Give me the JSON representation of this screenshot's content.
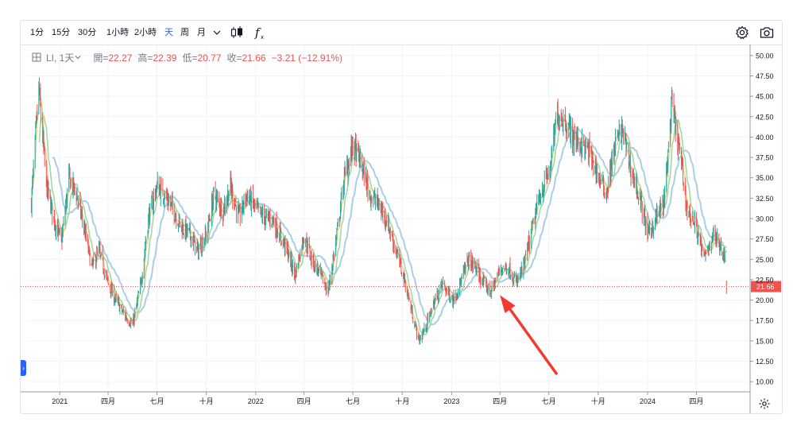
{
  "toolbar": {
    "intervals": [
      {
        "label": "1分",
        "active": false
      },
      {
        "label": "15分",
        "active": false
      },
      {
        "label": "30分",
        "active": false
      },
      {
        "label": "1小時",
        "active": false
      },
      {
        "label": "2小時",
        "active": false
      },
      {
        "label": "天",
        "active": true
      },
      {
        "label": "周",
        "active": false
      },
      {
        "label": "月",
        "active": false
      }
    ],
    "more_icon": "chevron-down-icon",
    "chart_type_icon": "candles-icon",
    "indicators_icon": "fx-icon",
    "settings_icon": "gear-icon",
    "snapshot_icon": "camera-icon"
  },
  "legend": {
    "symbol": "LI, 1天",
    "open_label": "開=",
    "open": "22.27",
    "high_label": "高=",
    "high": "22.39",
    "low_label": "低=",
    "low": "20.77",
    "close_label": "收=",
    "close": "21.66",
    "change": "−3.21 (−12.91%)"
  },
  "colors": {
    "up": "#26a69a",
    "down": "#ef5350",
    "ma_short": "#f0d68a",
    "ma_mid": "#a5d6a7",
    "ma_long": "#a9cfe0",
    "price_line": "#ef5350",
    "arrow": "#f23b2e",
    "accent": "#2962ff"
  },
  "chart_data": {
    "type": "candlestick",
    "symbol": "LI",
    "interval": "1天",
    "y_axis": {
      "min": 8.75,
      "max": 51.25,
      "ticks": [
        "10.00",
        "12.50",
        "15.00",
        "17.50",
        "20.00",
        "22.50",
        "25.00",
        "27.50",
        "30.00",
        "32.50",
        "35.00",
        "37.50",
        "40.00",
        "42.50",
        "45.00",
        "47.50",
        "50.00"
      ]
    },
    "x_axis": {
      "start": "2020-11-01",
      "end": "2024-07-10",
      "ticks": [
        {
          "label": "2021",
          "date": "2021-01-01"
        },
        {
          "label": "四月",
          "date": "2021-04-01"
        },
        {
          "label": "七月",
          "date": "2021-07-01"
        },
        {
          "label": "十月",
          "date": "2021-10-01"
        },
        {
          "label": "2022",
          "date": "2022-01-01"
        },
        {
          "label": "四月",
          "date": "2022-04-01"
        },
        {
          "label": "七月",
          "date": "2022-07-01"
        },
        {
          "label": "十月",
          "date": "2022-10-01"
        },
        {
          "label": "2023",
          "date": "2023-01-01"
        },
        {
          "label": "四月",
          "date": "2023-04-01"
        },
        {
          "label": "七月",
          "date": "2023-07-01"
        },
        {
          "label": "十月",
          "date": "2023-10-01"
        },
        {
          "label": "2024",
          "date": "2024-01-01"
        },
        {
          "label": "四月",
          "date": "2024-04-01"
        }
      ]
    },
    "last_price": 21.66,
    "last_price_label": "21.66",
    "price_path": [
      [
        "2020-11-09",
        32
      ],
      [
        "2020-11-23",
        46
      ],
      [
        "2020-12-07",
        34
      ],
      [
        "2020-12-21",
        30
      ],
      [
        "2021-01-04",
        27
      ],
      [
        "2021-01-18",
        35
      ],
      [
        "2021-02-01",
        33
      ],
      [
        "2021-02-15",
        29
      ],
      [
        "2021-03-01",
        24
      ],
      [
        "2021-03-15",
        26
      ],
      [
        "2021-04-01",
        22
      ],
      [
        "2021-04-15",
        20
      ],
      [
        "2021-05-03",
        18
      ],
      [
        "2021-05-17",
        17
      ],
      [
        "2021-06-01",
        22
      ],
      [
        "2021-06-15",
        30
      ],
      [
        "2021-07-01",
        34
      ],
      [
        "2021-07-15",
        33
      ],
      [
        "2021-08-01",
        31
      ],
      [
        "2021-08-15",
        29
      ],
      [
        "2021-09-01",
        28
      ],
      [
        "2021-09-15",
        26
      ],
      [
        "2021-10-01",
        28
      ],
      [
        "2021-10-15",
        33
      ],
      [
        "2021-11-01",
        31
      ],
      [
        "2021-11-15",
        34
      ],
      [
        "2021-12-01",
        30
      ],
      [
        "2021-12-15",
        33
      ],
      [
        "2022-01-03",
        31
      ],
      [
        "2022-01-17",
        30
      ],
      [
        "2022-02-01",
        30
      ],
      [
        "2022-02-15",
        28
      ],
      [
        "2022-03-01",
        26
      ],
      [
        "2022-03-15",
        23
      ],
      [
        "2022-04-01",
        28
      ],
      [
        "2022-04-15",
        25
      ],
      [
        "2022-05-02",
        23
      ],
      [
        "2022-05-16",
        21
      ],
      [
        "2022-06-01",
        28
      ],
      [
        "2022-06-15",
        35
      ],
      [
        "2022-07-01",
        39
      ],
      [
        "2022-07-15",
        37
      ],
      [
        "2022-08-01",
        33
      ],
      [
        "2022-08-15",
        32
      ],
      [
        "2022-09-01",
        30
      ],
      [
        "2022-09-15",
        27
      ],
      [
        "2022-10-03",
        23
      ],
      [
        "2022-10-17",
        19
      ],
      [
        "2022-11-01",
        15
      ],
      [
        "2022-11-15",
        17
      ],
      [
        "2022-12-01",
        20
      ],
      [
        "2022-12-15",
        22
      ],
      [
        "2023-01-03",
        20
      ],
      [
        "2023-01-17",
        22
      ],
      [
        "2023-02-01",
        25
      ],
      [
        "2023-02-15",
        24
      ],
      [
        "2023-03-01",
        22
      ],
      [
        "2023-03-15",
        21
      ],
      [
        "2023-04-03",
        24
      ],
      [
        "2023-04-17",
        24
      ],
      [
        "2023-05-01",
        22
      ],
      [
        "2023-05-15",
        24
      ],
      [
        "2023-06-01",
        29
      ],
      [
        "2023-06-15",
        33
      ],
      [
        "2023-07-03",
        36
      ],
      [
        "2023-07-17",
        43
      ],
      [
        "2023-08-01",
        42
      ],
      [
        "2023-08-15",
        40
      ],
      [
        "2023-09-01",
        39
      ],
      [
        "2023-09-15",
        38
      ],
      [
        "2023-10-02",
        35
      ],
      [
        "2023-10-16",
        33
      ],
      [
        "2023-11-01",
        39
      ],
      [
        "2023-11-15",
        41
      ],
      [
        "2023-12-01",
        36
      ],
      [
        "2023-12-15",
        33
      ],
      [
        "2024-01-02",
        28
      ],
      [
        "2024-01-16",
        30
      ],
      [
        "2024-02-01",
        32
      ],
      [
        "2024-02-15",
        44
      ],
      [
        "2024-03-01",
        38
      ],
      [
        "2024-03-15",
        31
      ],
      [
        "2024-04-01",
        29
      ],
      [
        "2024-04-15",
        25
      ],
      [
        "2024-05-01",
        28
      ],
      [
        "2024-05-15",
        27
      ],
      [
        "2024-05-24",
        25
      ]
    ],
    "last_bar": {
      "open": 22.27,
      "high": 22.39,
      "low": 20.77,
      "close": 21.66
    }
  },
  "annotation": {
    "type": "arrow",
    "from": [
      "2023-07-15",
      11.0
    ],
    "to": [
      "2023-04-01",
      20.6
    ]
  }
}
